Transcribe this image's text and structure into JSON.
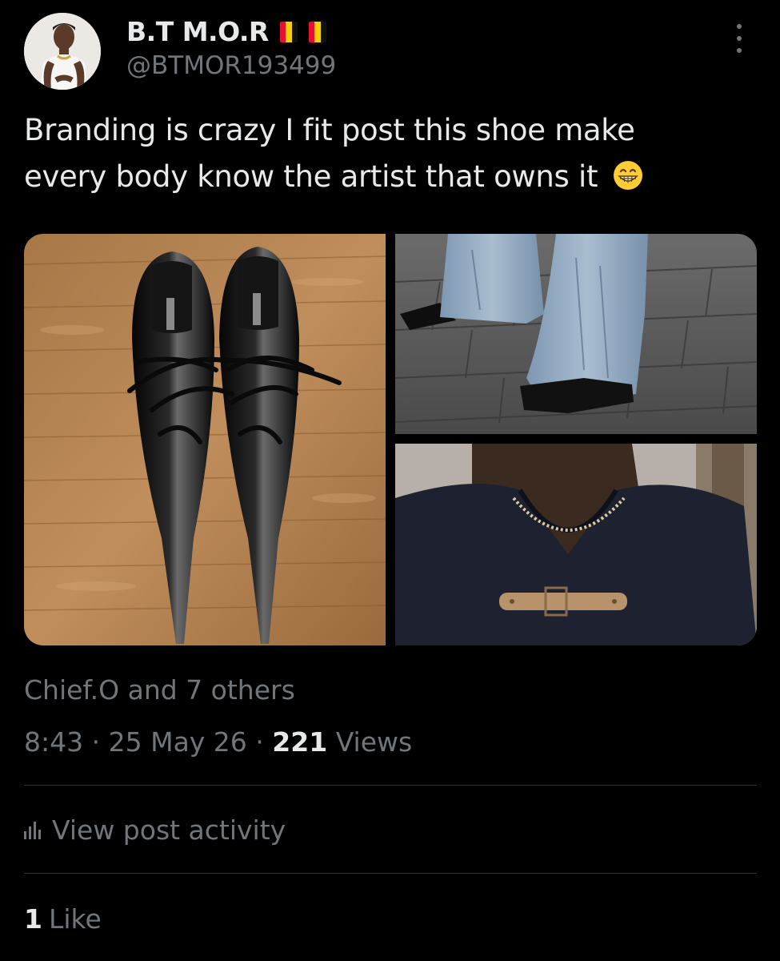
{
  "author": {
    "display_name": "B.T M.O.R",
    "handle": "@BTMOR193499",
    "flag_colors": [
      "#e8112d",
      "#f5d000",
      "#111111"
    ]
  },
  "tweet": {
    "text_line1": "Branding is crazy I fit post this shoe make",
    "text_line2": "every body know the artist that owns it",
    "emoji": "grinning-face-emoji"
  },
  "media": {
    "images": [
      "black-patent-pointed-shoes",
      "flared-jeans-on-pavement",
      "dark-shirt-with-brown-buckle"
    ]
  },
  "footer": {
    "liked_by": "Chief.O and 7 others",
    "time": "8:43",
    "separator": "·",
    "date": "25 May 26",
    "views_count": "221",
    "views_label": "Views",
    "activity_label": "View post activity",
    "likes_count": "1",
    "likes_label": "Like"
  },
  "colors": {
    "background": "#000000",
    "primary_text": "#e7e9ea",
    "secondary_text": "#71767b",
    "divider": "#2f3336"
  }
}
